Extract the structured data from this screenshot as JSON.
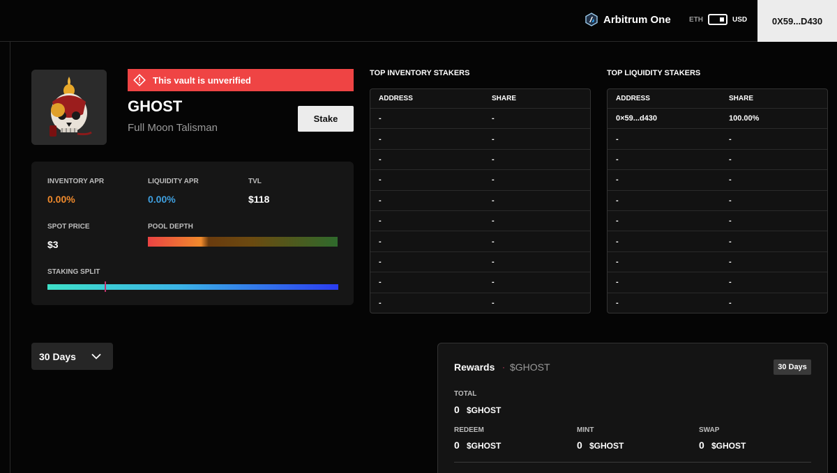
{
  "header": {
    "network_name": "Arbitrum One",
    "currency_left": "ETH",
    "currency_right": "USD",
    "wallet_address": "0X59...D430"
  },
  "vault": {
    "warning": "This vault is unverified",
    "name": "GHOST",
    "collection": "Full Moon Talisman",
    "stake_label": "Stake"
  },
  "stats": {
    "inventory_apr_label": "INVENTORY APR",
    "inventory_apr_value": "0.00%",
    "liquidity_apr_label": "LIQUIDITY APR",
    "liquidity_apr_value": "0.00%",
    "tvl_label": "TVL",
    "tvl_value": "$118",
    "spot_price_label": "SPOT PRICE",
    "spot_price_value": "$3",
    "pool_depth_label": "POOL DEPTH",
    "staking_split_label": "STAKING SPLIT",
    "staking_split_fraction": 0.2,
    "colors": {
      "inventory": "#f08a2c",
      "liquidity": "#3fa0e0",
      "warning": "#ef4444"
    }
  },
  "inventory_table": {
    "title": "TOP INVENTORY STAKERS",
    "col_address": "ADDRESS",
    "col_share": "SHARE",
    "rows": [
      [
        "-",
        "-"
      ],
      [
        "-",
        "-"
      ],
      [
        "-",
        "-"
      ],
      [
        "-",
        "-"
      ],
      [
        "-",
        "-"
      ],
      [
        "-",
        "-"
      ],
      [
        "-",
        "-"
      ],
      [
        "-",
        "-"
      ],
      [
        "-",
        "-"
      ],
      [
        "-",
        "-"
      ]
    ]
  },
  "liquidity_table": {
    "title": "TOP LIQUIDITY STAKERS",
    "col_address": "ADDRESS",
    "col_share": "SHARE",
    "rows": [
      [
        "0×59...d430",
        "100.00%"
      ],
      [
        "-",
        "-"
      ],
      [
        "-",
        "-"
      ],
      [
        "-",
        "-"
      ],
      [
        "-",
        "-"
      ],
      [
        "-",
        "-"
      ],
      [
        "-",
        "-"
      ],
      [
        "-",
        "-"
      ],
      [
        "-",
        "-"
      ],
      [
        "-",
        "-"
      ]
    ]
  },
  "period_selector": {
    "selected": "30 Days"
  },
  "rewards": {
    "title": "Rewards",
    "separator": "·",
    "token": "$GHOST",
    "period_badge": "30 Days",
    "total_label": "TOTAL",
    "total_value": "0",
    "total_unit": "$GHOST",
    "redeem_label": "REDEEM",
    "redeem_value": "0",
    "redeem_unit": "$GHOST",
    "mint_label": "MINT",
    "mint_value": "0",
    "mint_unit": "$GHOST",
    "swap_label": "SWAP",
    "swap_value": "0",
    "swap_unit": "$GHOST"
  }
}
